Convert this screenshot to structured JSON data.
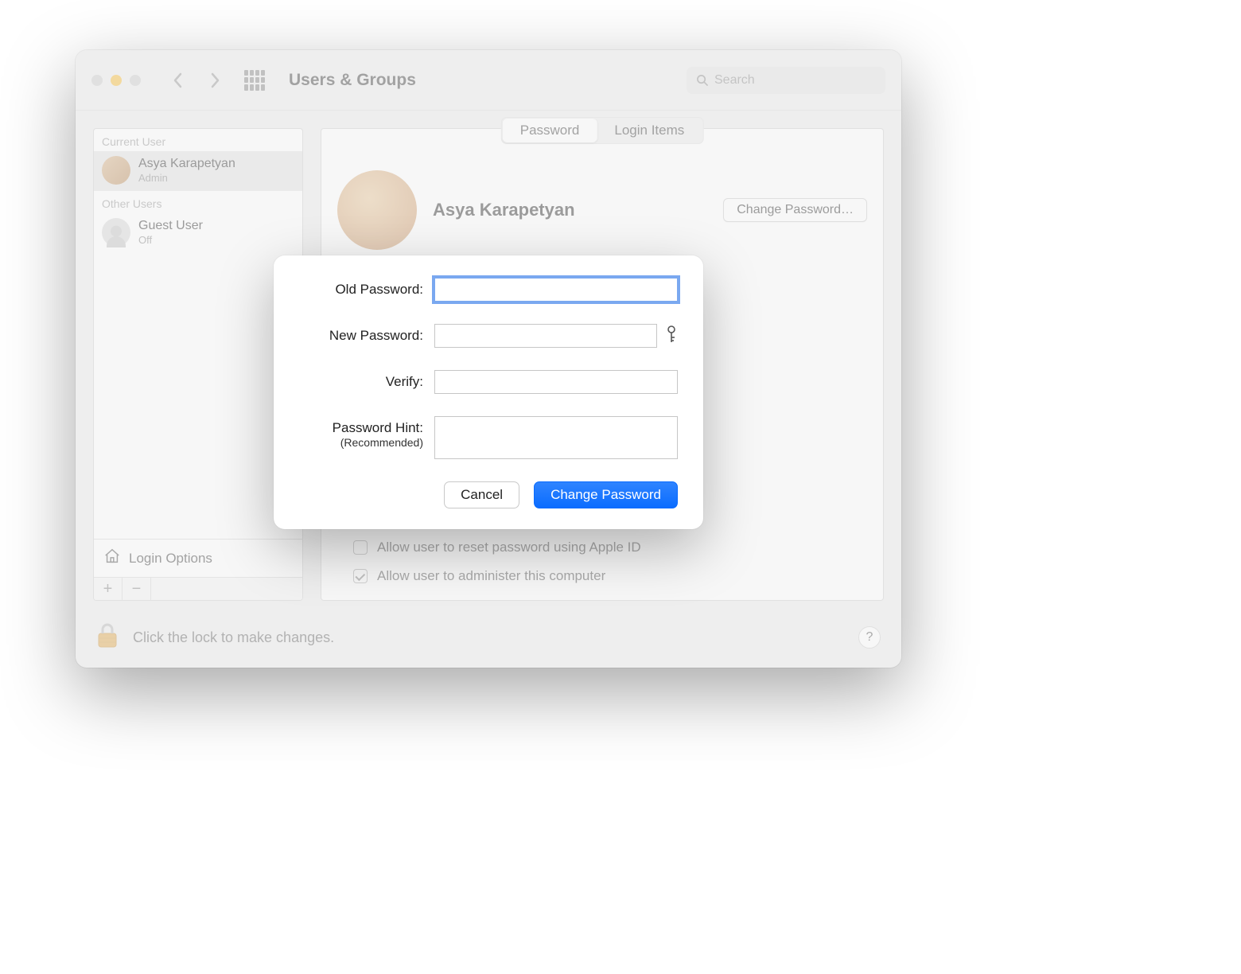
{
  "toolbar": {
    "title": "Users & Groups",
    "search_placeholder": "Search"
  },
  "sidebar": {
    "section_current": "Current User",
    "section_other": "Other Users",
    "users": [
      {
        "name": "Asya Karapetyan",
        "role": "Admin"
      },
      {
        "name": "Guest User",
        "role": "Off"
      }
    ],
    "login_options": "Login Options"
  },
  "content": {
    "tabs": {
      "password": "Password",
      "login_items": "Login Items"
    },
    "profile_name": "Asya Karapetyan",
    "change_password_btn": "Change Password…",
    "check_reset_appleid": "Allow user to reset password using Apple ID",
    "check_admin": "Allow user to administer this computer"
  },
  "footer": {
    "lock_text": "Click the lock to make changes.",
    "help": "?"
  },
  "dialog": {
    "old_password_label": "Old Password:",
    "new_password_label": "New Password:",
    "verify_label": "Verify:",
    "hint_label": "Password Hint:",
    "hint_sub": "(Recommended)",
    "cancel": "Cancel",
    "change": "Change Password",
    "values": {
      "old": "",
      "new": "",
      "verify": "",
      "hint": ""
    }
  }
}
